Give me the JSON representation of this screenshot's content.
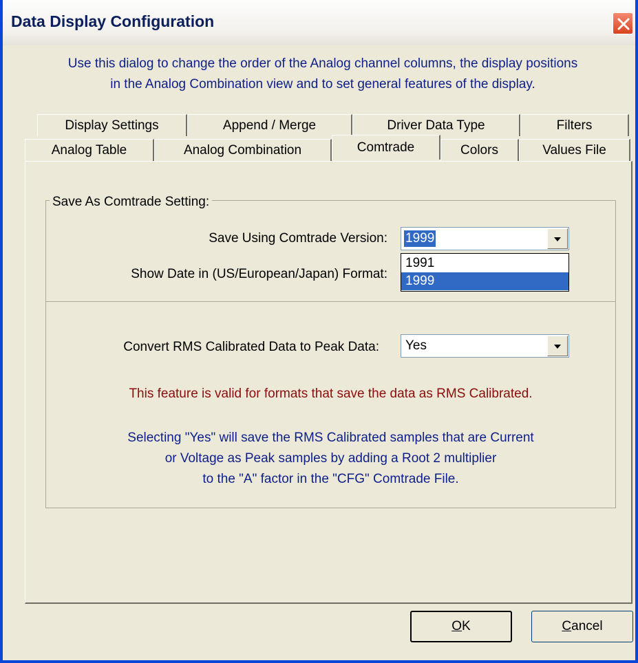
{
  "window": {
    "title": "Data Display Configuration",
    "intro_line1": "Use this dialog to change the order of the Analog channel columns, the display positions",
    "intro_line2": "in the Analog Combination view and to set general features of the display."
  },
  "tabs_row1": [
    "Display Settings",
    "Append / Merge",
    "Driver Data Type",
    "Filters"
  ],
  "tabs_row2": [
    "Analog Table",
    "Analog Combination",
    "Comtrade",
    "Colors",
    "Values File"
  ],
  "active_tab": "Comtrade",
  "group": {
    "title": "Save As Comtrade Setting:",
    "version_label": "Save Using Comtrade Version:",
    "version_value": "1999",
    "version_options": [
      "1991",
      "1999"
    ],
    "date_label": "Show Date in (US/European/Japan) Format:",
    "convert_label": "Convert RMS Calibrated Data to Peak Data:",
    "convert_value": "Yes",
    "note_red": "This feature is valid for formats that save the data as RMS Calibrated.",
    "note_blue_1": "Selecting \"Yes\" will save the RMS Calibrated samples that are Current",
    "note_blue_2": "or Voltage as Peak samples by adding a Root 2 multiplier",
    "note_blue_3": "to the \"A\" factor in the \"CFG\" Comtrade File."
  },
  "buttons": {
    "ok_mnemonic": "O",
    "ok_rest": "K",
    "cancel_mnemonic": "C",
    "cancel_rest": "ancel"
  },
  "colors": {
    "window_border": "#0a46d8",
    "dialog_bg": "#ece9d8",
    "selection": "#316ac5",
    "note_red": "#8b0d0d",
    "note_blue": "#0e1f8a",
    "close_button": "#d8441f"
  },
  "icons": {
    "close": "close-x-icon",
    "dropdown": "chevron-down-icon"
  }
}
